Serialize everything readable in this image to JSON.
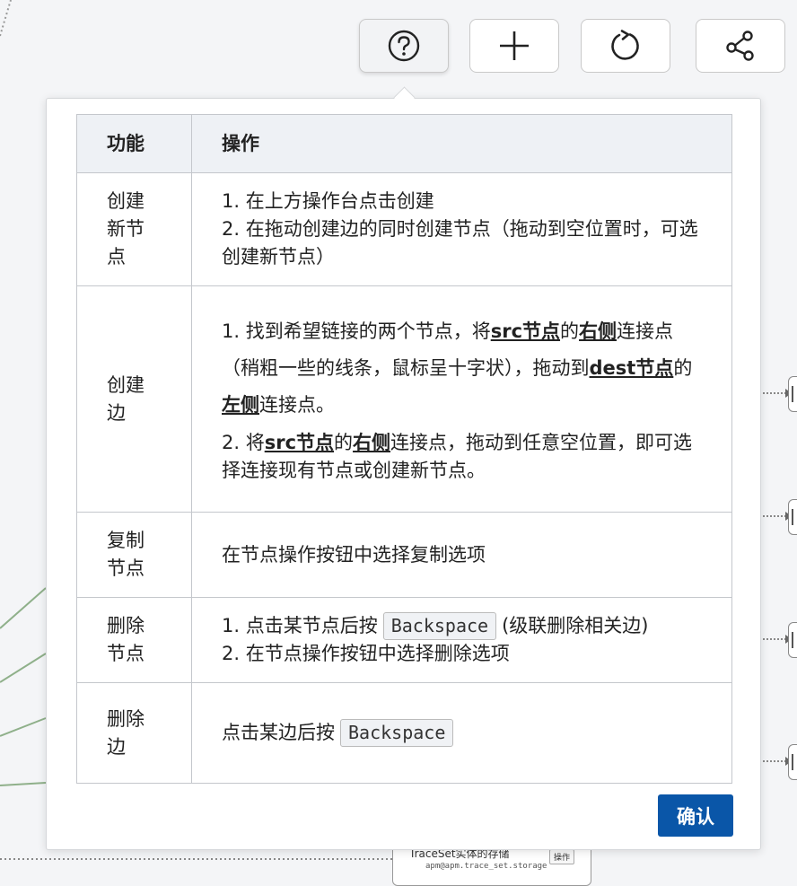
{
  "toolbar": {
    "help_icon": "help-circle-icon",
    "add_icon": "plus-icon",
    "refresh_icon": "refresh-icon",
    "share_icon": "share-icon"
  },
  "help_table": {
    "headers": [
      "功能",
      "操作"
    ],
    "rows": [
      {
        "func": "创建新节点",
        "ops": [
          "1. 在上方操作台点击创建",
          "2. 在拖动创建边的同时创建节点（拖动到空位置时，可选创建新节点）"
        ]
      },
      {
        "func": "创建边",
        "ops_1": {
          "p1": "1. 找到希望链接的两个节点，将",
          "b1": "src节点",
          "p2": "的",
          "b2": "右侧",
          "p3": "连接点（稍粗一些的线条，鼠标呈十字状），拖动到",
          "b3": "dest节点",
          "p4": "的",
          "b4": "左侧",
          "p5": "连接点。"
        },
        "ops_2": {
          "p1": "2. 将",
          "b1": "src节点",
          "p2": "的",
          "b2": "右侧",
          "p3": "连接点，拖动到任意空位置，即可选择连接现有节点或创建新节点。"
        }
      },
      {
        "func": "复制节点",
        "ops": [
          "在节点操作按钮中选择复制选项"
        ]
      },
      {
        "func": "删除节点",
        "ops_1a": "1. 点击某节点后按",
        "key": "Backspace",
        "ops_1b": "(级联删除相关边)",
        "ops_2": "2. 在节点操作按钮中选择删除选项"
      },
      {
        "func": "删除边",
        "ops_a": "点击某边后按",
        "key": "Backspace"
      }
    ]
  },
  "confirm_label": "确认",
  "background_node": {
    "title": "TraceSet实体的存储",
    "subtitle": "apm@apm.trace_set.storage",
    "tag": "操作"
  },
  "colors": {
    "primary": "#0a56a8",
    "header_bg": "#eef1f5",
    "edge_green": "#8fb08a"
  }
}
